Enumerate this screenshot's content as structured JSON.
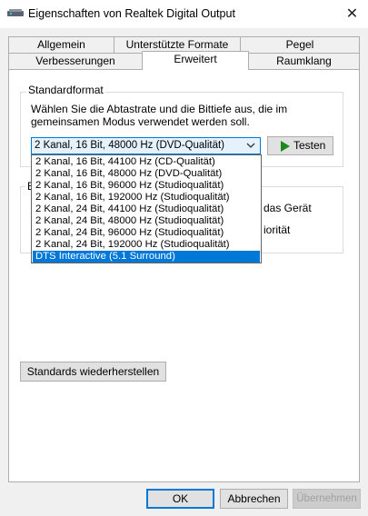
{
  "window": {
    "title": "Eigenschaften von Realtek Digital Output",
    "close_glyph": "✕"
  },
  "tabs_top": [
    "Allgemein",
    "Unterstützte Formate",
    "Pegel"
  ],
  "tabs_bottom": [
    "Verbesserungen",
    "Erweitert",
    "Raumklang"
  ],
  "selected_tab": "Erweitert",
  "default_format": {
    "group_title": "Standardformat",
    "description_line1": "Wählen Sie die Abtastrate und die Bittiefe aus, die im",
    "description_line2": "gemeinsamen Modus verwendet werden soll.",
    "selected_value": "2 Kanal, 16 Bit, 48000 Hz (DVD-Qualität)",
    "test_label": "Testen",
    "options": [
      "2 Kanal, 16 Bit, 44100 Hz (CD-Qualität)",
      "2 Kanal, 16 Bit, 48000 Hz (DVD-Qualität)",
      "2 Kanal, 16 Bit, 96000 Hz (Studioqualität)",
      "2 Kanal, 16 Bit, 192000 Hz (Studioqualität)",
      "2 Kanal, 24 Bit, 44100 Hz (Studioqualität)",
      "2 Kanal, 24 Bit, 48000 Hz (Studioqualität)",
      "2 Kanal, 24 Bit, 96000 Hz (Studioqualität)",
      "2 Kanal, 24 Bit, 192000 Hz (Studioqualität)",
      "DTS Interactive (5.1 Surround)"
    ],
    "highlighted_option": "DTS Interactive (5.1 Surround)"
  },
  "exclusive_mode": {
    "group_title_fragment": "E",
    "line1_fragment": "das Gerät",
    "line2_fragment": "iorität"
  },
  "restore_defaults_label": "Standards wiederherstellen",
  "footer": {
    "ok": "OK",
    "cancel": "Abbrechen",
    "apply": "Übernehmen"
  },
  "colors": {
    "accent": "#0078d7",
    "play_icon": "#1a8a1a"
  },
  "icons": [
    "speaker-icon",
    "close-icon",
    "chevron-down-icon",
    "play-icon"
  ]
}
